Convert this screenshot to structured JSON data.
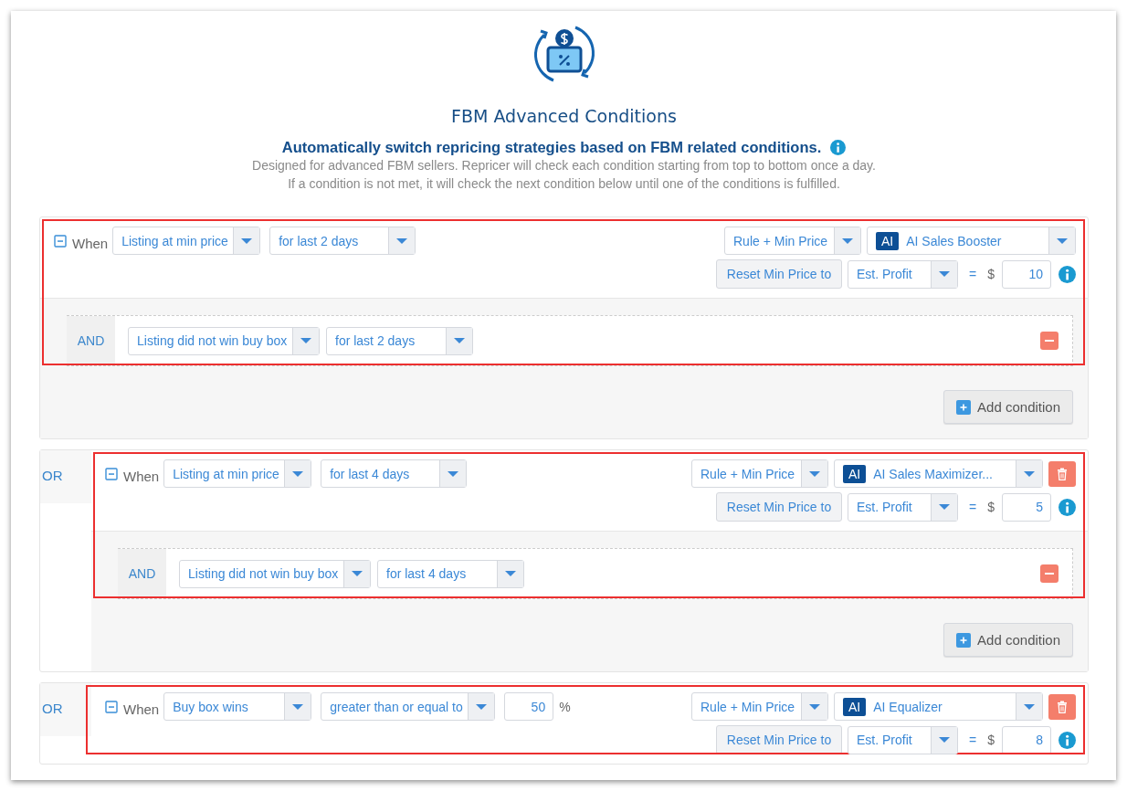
{
  "header": {
    "title": "FBM Advanced Conditions",
    "subtitle": "Automatically switch repricing strategies based on FBM related conditions.",
    "description": [
      "Designed for advanced FBM sellers. Repricer will check each condition starting from top to bottom once a day.",
      "If a condition is not met, it will check the next condition below until one of the conditions is fulfilled."
    ]
  },
  "groups": [
    {
      "highlighted": true,
      "when_label": "When",
      "condition": "Listing at min price",
      "operator": "for last 2 days",
      "strategy_mode": "Rule + Min Price",
      "ai_badge": "AI",
      "strategy": "AI Sales Booster",
      "deletable": false,
      "reset_label": "Reset Min Price to",
      "reset_base": "Est. Profit",
      "equals": "=",
      "currency": "$",
      "amount": "10",
      "and_conditions": [
        {
          "label": "AND",
          "condition": "Listing did not win buy box",
          "operator": "for last 2 days"
        }
      ],
      "add_button": "Add condition"
    },
    {
      "connector": "OR",
      "highlighted": true,
      "when_label": "When",
      "condition": "Listing at min price",
      "operator": "for last 4 days",
      "strategy_mode": "Rule + Min Price",
      "ai_badge": "AI",
      "strategy": "AI Sales Maximizer...",
      "deletable": true,
      "reset_label": "Reset Min Price to",
      "reset_base": "Est. Profit",
      "equals": "=",
      "currency": "$",
      "amount": "5",
      "and_conditions": [
        {
          "label": "AND",
          "condition": "Listing did not win buy box",
          "operator": "for last 4 days"
        }
      ],
      "add_button": "Add condition"
    },
    {
      "connector": "OR",
      "highlighted": true,
      "when_label": "When",
      "condition": "Buy box wins",
      "operator": "greater than or equal to",
      "threshold": "50",
      "threshold_unit": "%",
      "strategy_mode": "Rule + Min Price",
      "ai_badge": "AI",
      "strategy": "AI Equalizer",
      "deletable": true,
      "reset_label": "Reset Min Price to",
      "reset_base": "Est. Profit",
      "equals": "=",
      "currency": "$",
      "amount": "8"
    }
  ]
}
